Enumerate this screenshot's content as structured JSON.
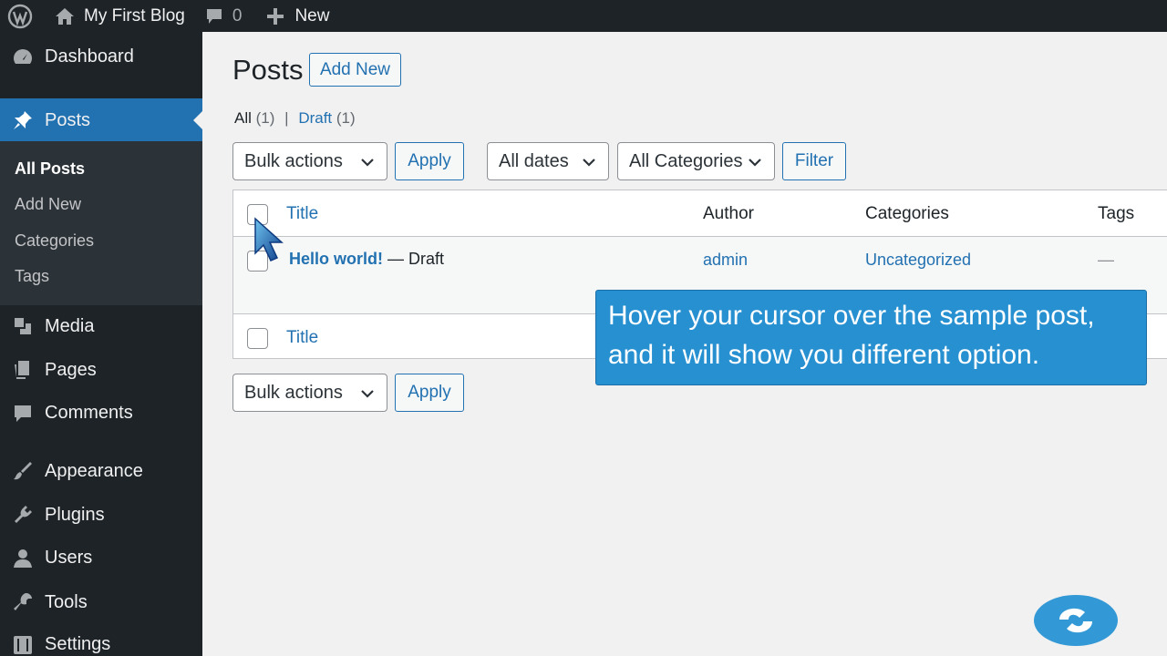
{
  "adminbar": {
    "site_name": "My First Blog",
    "comments_count": "0",
    "new_label": "New"
  },
  "sidebar": {
    "items": [
      {
        "label": "Dashboard"
      },
      {
        "label": "Posts"
      },
      {
        "label": "Media"
      },
      {
        "label": "Pages"
      },
      {
        "label": "Comments"
      },
      {
        "label": "Appearance"
      },
      {
        "label": "Plugins"
      },
      {
        "label": "Users"
      },
      {
        "label": "Tools"
      },
      {
        "label": "Settings"
      }
    ],
    "submenu": [
      {
        "label": "All Posts"
      },
      {
        "label": "Add New"
      },
      {
        "label": "Categories"
      },
      {
        "label": "Tags"
      }
    ]
  },
  "main": {
    "title": "Posts",
    "add_new": "Add New",
    "filters": {
      "all": "All",
      "all_count": "(1)",
      "separator": "|",
      "draft": "Draft",
      "draft_count": "(1)"
    },
    "bulk_actions": "Bulk actions",
    "apply": "Apply",
    "all_dates": "All dates",
    "all_categories": "All Categories",
    "filter": "Filter",
    "table": {
      "columns": [
        "Title",
        "Author",
        "Categories",
        "Tags"
      ],
      "rows": [
        {
          "title": "Hello world!",
          "state": "— Draft",
          "author": "admin",
          "category": "Uncategorized",
          "tags": "—"
        }
      ]
    }
  },
  "tooltip": {
    "line1": "Hover your cursor over the sample post,",
    "line2": "and it will show you different option."
  },
  "colors": {
    "accent": "#2271b1",
    "sidebar_bg": "#1d2327",
    "tooltip_bg": "#2790d1"
  }
}
